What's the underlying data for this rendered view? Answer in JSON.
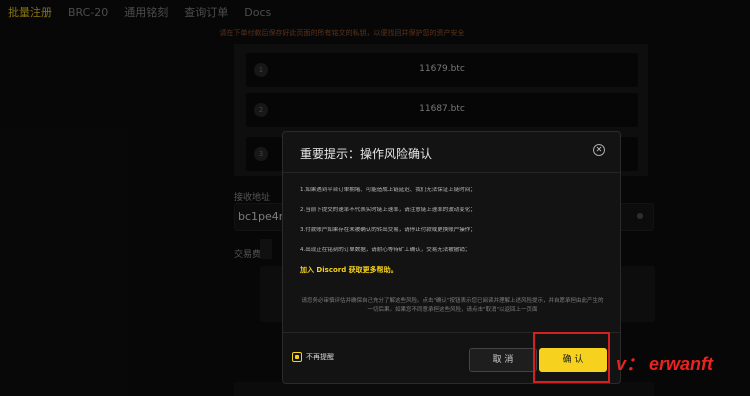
{
  "nav": {
    "items": [
      "批量注册",
      "BRC-20",
      "通用铭刻",
      "查询订单",
      "Docs"
    ],
    "active_index": 0
  },
  "page": {
    "notice": "请在下单付款后保存好此页面的所有铭文的私钥，以便找回并保护您的资产安全",
    "tickets": [
      {
        "number": "1",
        "name": "11679.btc"
      },
      {
        "number": "2",
        "name": "11687.btc"
      },
      {
        "number": "3",
        "name": ""
      }
    ],
    "receive_label": "接收地址",
    "receive_value": "bc1pe4m",
    "fee_label": "交易费率"
  },
  "modal": {
    "title": "重要提示：操作风险确认",
    "rules": [
      "1.如果遇到平台订单拥堵、可能造成上链延迟、我们无法保证上链时间；",
      "2.当前下提交的速率不代表实时链上速率，请注意链上速率的波动变化；",
      "3.付款账户如果存在未被确认的转出交易，请停止付款或更换账户操作；",
      "4.出现正在铭刻的订单数据，请耐心等待矿工确认，交易无法被撤销；"
    ],
    "discord_text": "加入 Discord 获取更多帮助。",
    "disclaimer": "请您务必审慎评估并确保自己充分了解这些风险。点击\"确认\"按钮表示您已阅读并理解上述风险提示，并自愿承担由此产生的一切后果。如果您不同意承担这些风险，请点击\"取消\"以返回上一页面",
    "dont_remind_label": "不再提醒",
    "cancel_label": "取 消",
    "confirm_label": "确 认"
  },
  "watermark": "v： erwanft",
  "colors": {
    "accent": "#f6d21e",
    "highlight": "#d42020",
    "watermark": "#e62420"
  }
}
